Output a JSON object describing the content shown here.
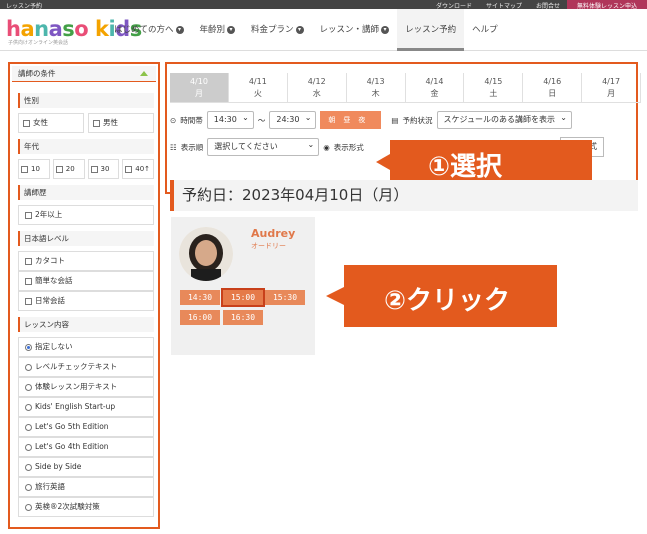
{
  "topbar": {
    "left": "レッスン予約",
    "links": [
      "ダウンロード",
      "サイトマップ",
      "お問合せ"
    ],
    "trial": "無料体験レッスン申込"
  },
  "logo": {
    "chars": [
      "h",
      "a",
      "n",
      "a",
      "s",
      "o",
      " ",
      "k",
      "i",
      "d",
      "s"
    ],
    "sub": "子供向けオンライン英会話"
  },
  "nav": [
    {
      "label": "はじめての方へ",
      "chevron": true
    },
    {
      "label": "年齢別",
      "chevron": true
    },
    {
      "label": "料金プラン",
      "chevron": true
    },
    {
      "label": "レッスン・講師",
      "chevron": true
    },
    {
      "label": "レッスン予約",
      "chevron": false,
      "active": true
    },
    {
      "label": "ヘルプ",
      "chevron": false
    }
  ],
  "sidebar": {
    "title": "講師の条件",
    "gender": {
      "title": "性別",
      "options": [
        "女性",
        "男性"
      ]
    },
    "age": {
      "title": "年代",
      "options": [
        "10",
        "20",
        "30",
        "40↑"
      ]
    },
    "career": {
      "title": "講師歴",
      "options": [
        "2年以上"
      ]
    },
    "japanese": {
      "title": "日本語レベル",
      "options": [
        "カタコト",
        "簡単な会話",
        "日常会話"
      ]
    },
    "content": {
      "title": "レッスン内容",
      "options": [
        "指定しない",
        "レベルチェックテキスト",
        "体験レッスン用テキスト",
        "Kids' English Start-up",
        "Let's Go 5th Edition",
        "Let's Go 4th Edition",
        "Side by Side",
        "旅行英語",
        "英検®2次試験対策"
      ],
      "selected": 0
    }
  },
  "dates": [
    {
      "date": "4/10",
      "day": "月",
      "selected": true
    },
    {
      "date": "4/11",
      "day": "火"
    },
    {
      "date": "4/12",
      "day": "水"
    },
    {
      "date": "4/13",
      "day": "木"
    },
    {
      "date": "4/14",
      "day": "金"
    },
    {
      "date": "4/15",
      "day": "土"
    },
    {
      "date": "4/16",
      "day": "日"
    },
    {
      "date": "4/17",
      "day": "月"
    }
  ],
  "filters": {
    "time_label": "時間帯",
    "time_from": "14:30",
    "time_sep": "〜",
    "time_to": "24:30",
    "period_button": "朝昼夜",
    "status_label": "予約状況",
    "status_value": "スケジュールのある講師を表示",
    "order_label": "表示順",
    "order_value": "選択してください",
    "format_label": "表示形式",
    "format_tail": "式"
  },
  "callouts": {
    "step1": "①選択",
    "step2": "②クリック",
    "color": "#e35a1e"
  },
  "results": {
    "heading": "予約日：2023年04月10日（月）"
  },
  "teacher": {
    "name": "Audrey",
    "kana": "オードリー",
    "slots": [
      "14:30",
      "15:00",
      "15:30",
      "16:00",
      "16:30"
    ],
    "highlighted": "15:00"
  },
  "colors": {
    "accent": "#e35a1e",
    "slot": "#e8895a",
    "trial": "#b0365a"
  }
}
